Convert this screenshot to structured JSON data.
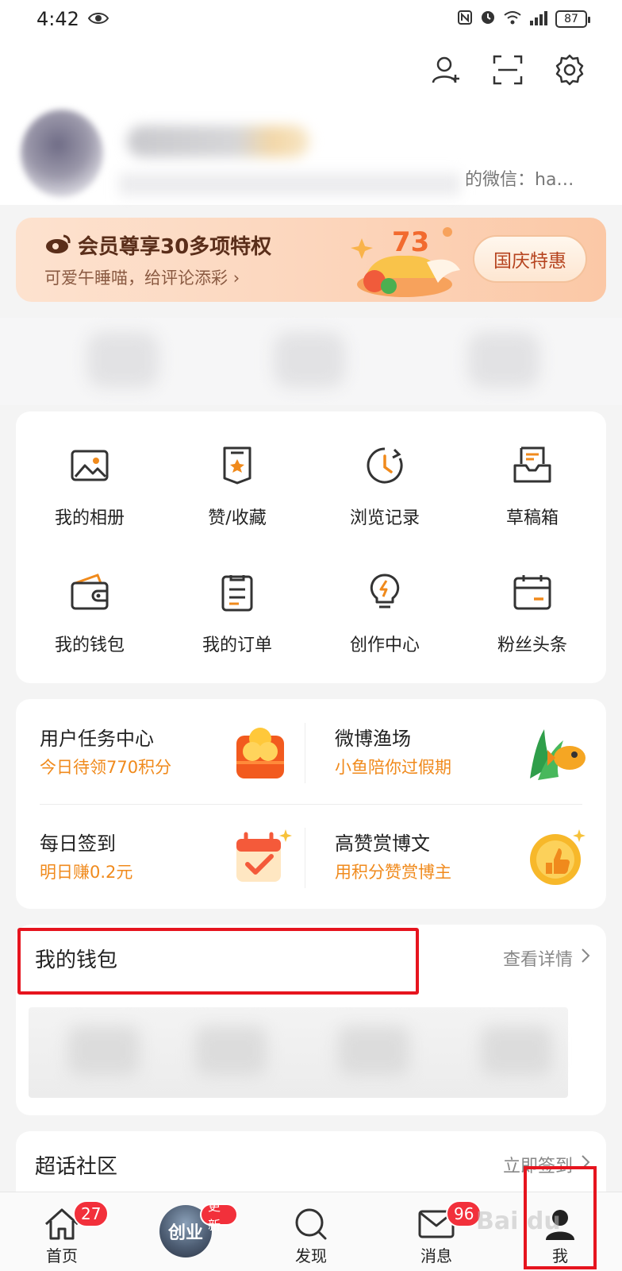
{
  "status_bar": {
    "time": "4:42",
    "battery": "87"
  },
  "profile": {
    "wechat_text": "的微信：ha…"
  },
  "vip_banner": {
    "title": "会员尊享30多项特权",
    "subtitle": "可爱午睡喵，给评论添彩",
    "button": "国庆特惠",
    "badge_number": "73"
  },
  "grid": [
    {
      "label": "我的相册",
      "icon": "photo-icon"
    },
    {
      "label": "赞/收藏",
      "icon": "bookmark-star-icon"
    },
    {
      "label": "浏览记录",
      "icon": "history-clock-icon"
    },
    {
      "label": "草稿箱",
      "icon": "draft-tray-icon"
    },
    {
      "label": "我的钱包",
      "icon": "wallet-icon"
    },
    {
      "label": "我的订单",
      "icon": "order-list-icon"
    },
    {
      "label": "创作中心",
      "icon": "lightbulb-icon"
    },
    {
      "label": "粉丝头条",
      "icon": "calendar-icon"
    }
  ],
  "tasks": [
    {
      "title": "用户任务中心",
      "subtitle": "今日待领770积分",
      "icon": "coin-gift-icon"
    },
    {
      "title": "微博渔场",
      "subtitle": "小鱼陪你过假期",
      "icon": "fish-icon"
    },
    {
      "title": "每日签到",
      "subtitle": "明日赚0.2元",
      "icon": "calendar-check-icon"
    },
    {
      "title": "高赞赏博文",
      "subtitle": "用积分赞赏博主",
      "icon": "thumbs-up-coin-icon"
    }
  ],
  "wallet_section": {
    "title": "我的钱包",
    "more": "查看详情"
  },
  "chaohua_section": {
    "title": "超话社区",
    "more": "立即签到"
  },
  "tabbar": {
    "home": {
      "label": "首页",
      "badge": "27"
    },
    "create": {
      "avatar_text": "创业",
      "badge": "更新"
    },
    "discover": {
      "label": "发现"
    },
    "messages": {
      "label": "消息",
      "badge": "96"
    },
    "me": {
      "label": "我"
    }
  },
  "watermark": "Bai du",
  "colors": {
    "accent": "#f08a1c",
    "highlight": "#e6141e",
    "badge": "#f2303b"
  }
}
